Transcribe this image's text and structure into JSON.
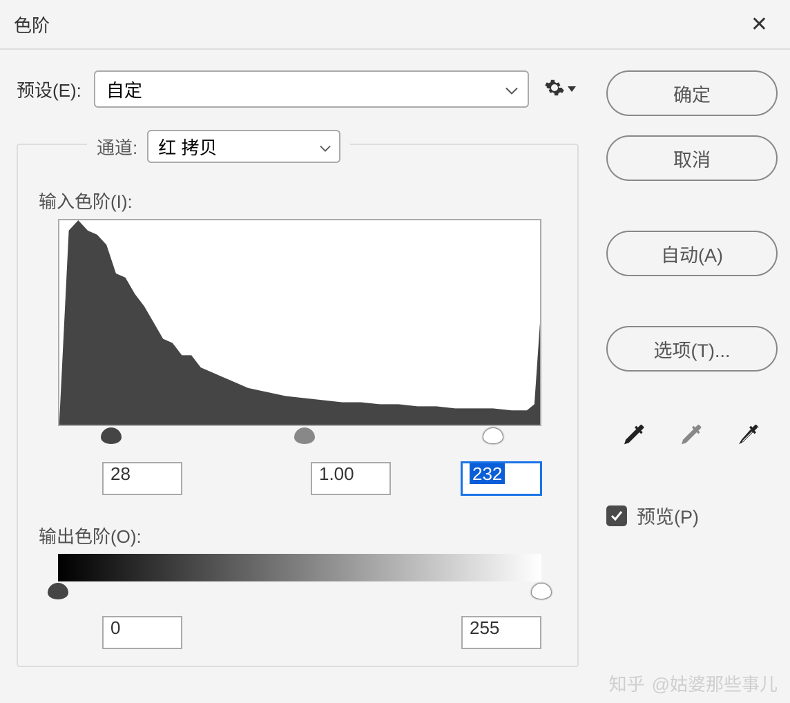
{
  "dialog": {
    "title": "色阶"
  },
  "preset": {
    "label": "预设(E):",
    "value": "自定"
  },
  "channel": {
    "label": "通道:",
    "value": "红 拷贝"
  },
  "input_levels": {
    "label": "输入色阶(I):",
    "black": "28",
    "gamma": "1.00",
    "white": "232"
  },
  "output_levels": {
    "label": "输出色阶(O):",
    "black": "0",
    "white": "255"
  },
  "buttons": {
    "ok": "确定",
    "cancel": "取消",
    "auto": "自动(A)",
    "options": "选项(T)..."
  },
  "preview": {
    "label": "预览(P)",
    "checked": true
  },
  "slider_positions": {
    "input_black_pct": 11,
    "input_gray_pct": 51,
    "input_white_pct": 90,
    "output_black_pct": 0,
    "output_white_pct": 100
  },
  "watermark": {
    "brand": "知乎",
    "author": "@姑婆那些事儿"
  },
  "chart_data": {
    "type": "area",
    "title": "",
    "xlabel": "",
    "ylabel": "",
    "xlim": [
      0,
      255
    ],
    "ylim": [
      0,
      1
    ],
    "x": [
      0,
      5,
      10,
      15,
      20,
      25,
      30,
      35,
      40,
      45,
      50,
      55,
      60,
      65,
      70,
      75,
      80,
      85,
      90,
      95,
      100,
      110,
      120,
      130,
      140,
      150,
      160,
      170,
      180,
      190,
      200,
      210,
      220,
      230,
      240,
      248,
      252,
      255
    ],
    "values": [
      0.02,
      0.95,
      1.0,
      0.95,
      0.93,
      0.88,
      0.74,
      0.72,
      0.64,
      0.58,
      0.5,
      0.42,
      0.4,
      0.34,
      0.34,
      0.28,
      0.26,
      0.24,
      0.22,
      0.2,
      0.18,
      0.16,
      0.14,
      0.13,
      0.12,
      0.11,
      0.11,
      0.1,
      0.1,
      0.09,
      0.09,
      0.08,
      0.08,
      0.08,
      0.07,
      0.07,
      0.1,
      0.5
    ]
  }
}
